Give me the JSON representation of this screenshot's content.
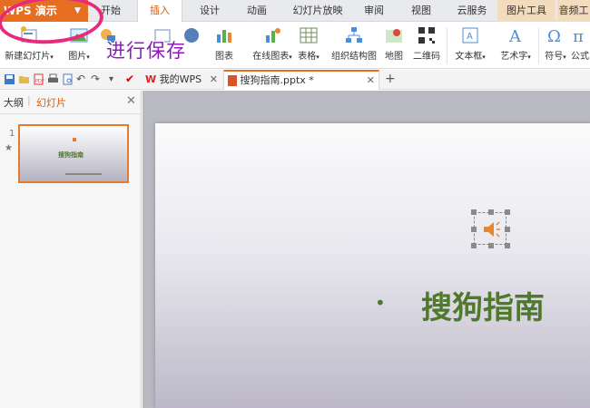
{
  "app": {
    "button_label": "WPS 演示"
  },
  "tabs": [
    {
      "label": "开始"
    },
    {
      "label": "插入"
    },
    {
      "label": "设计"
    },
    {
      "label": "动画"
    },
    {
      "label": "幻灯片放映"
    },
    {
      "label": "审阅"
    },
    {
      "label": "视图"
    },
    {
      "label": "云服务"
    },
    {
      "label": "图片工具"
    },
    {
      "label": "音频工"
    }
  ],
  "ribbon": {
    "new_slide": "新建幻灯片",
    "picture": "图片",
    "chart": "图表",
    "online_chart": "在线图表",
    "table": "表格",
    "org_chart": "组织结构图",
    "map": "地图",
    "qrcode": "二维码",
    "textbox": "文本框",
    "wordart": "艺术字",
    "symbol": "符号",
    "formula": "公式"
  },
  "annotation": {
    "text": "进行保存"
  },
  "doc_tabs": [
    {
      "label": "我的WPS"
    },
    {
      "label": "搜狗指南.pptx *"
    }
  ],
  "panel": {
    "tab_outline": "大纲",
    "tab_slides": "幻灯片",
    "slide_number": "1",
    "thumb_title": "搜狗指南"
  },
  "slide": {
    "title": "搜狗指南",
    "bullet": "•"
  },
  "colors": {
    "accent": "#e66e21",
    "title_green": "#4f7a2c",
    "annotation_pink": "#e8297c",
    "annotation_purple": "#8b1cb8"
  }
}
